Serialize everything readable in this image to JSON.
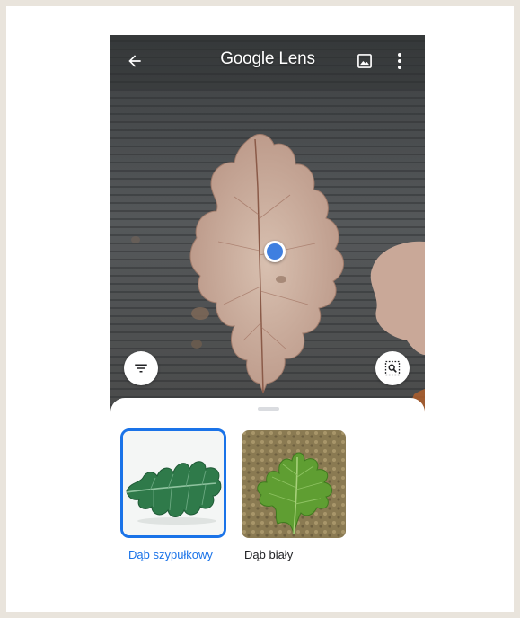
{
  "app": {
    "title_google": "Google",
    "title_lens": "Lens"
  },
  "icons": {
    "back": "arrow-back-icon",
    "gallery": "image-gallery-icon",
    "more": "more-vert-icon",
    "filter": "filter-icon",
    "search_region": "search-region-icon"
  },
  "colors": {
    "accent": "#1a73e8",
    "focus_dot": "#3f7fe0"
  },
  "results": [
    {
      "label": "Dąb szypułkowy",
      "selected": true
    },
    {
      "label": "Dąb biały",
      "selected": false
    }
  ]
}
